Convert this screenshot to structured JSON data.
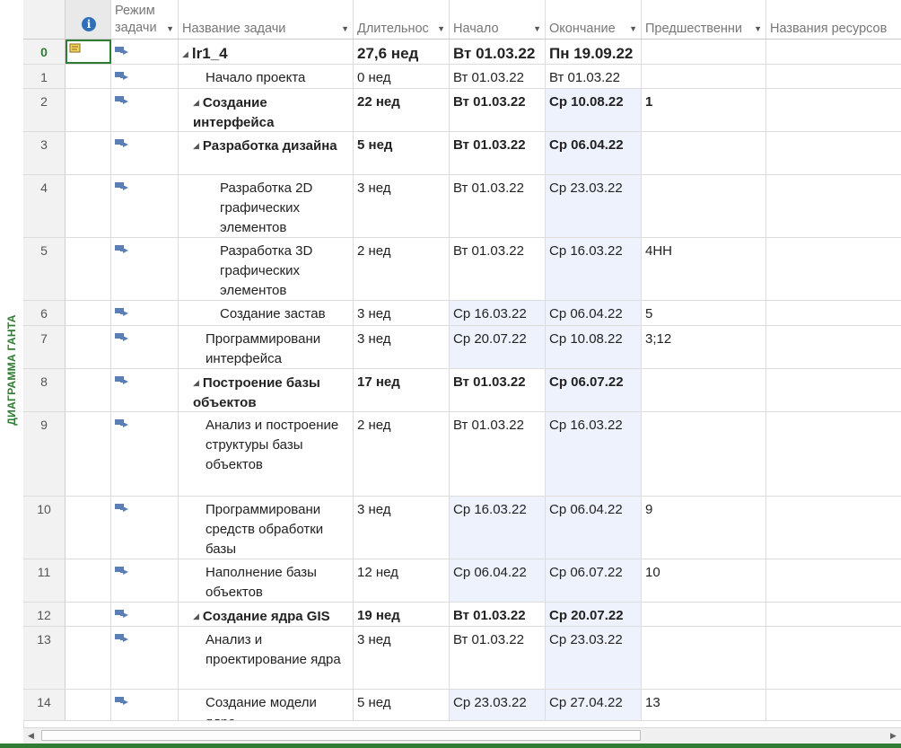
{
  "view_label": "ДИАГРАММА ГАНТА",
  "colors": {
    "accent": "#2e7d32",
    "highlight": "#eef2fc",
    "mode_icon": "#5b7fb4"
  },
  "columns": {
    "info_icon": "info-icon",
    "mode": "Режим задачи",
    "name": "Название задачи",
    "duration": "Длительнос",
    "start": "Начало",
    "finish": "Окончание",
    "predecessors": "Предшественни",
    "resources": "Названия ресурсов"
  },
  "rows": [
    {
      "id": "0",
      "name": "lr1_4",
      "duration": "27,6 нед",
      "start": "Вт 01.03.22",
      "finish": "Пн 19.09.22",
      "pred": "",
      "level": 0,
      "summary": true
    },
    {
      "id": "1",
      "name": "Начало проекта",
      "duration": "0 нед",
      "start": "Вт 01.03.22",
      "finish": "Вт 01.03.22",
      "pred": "",
      "level": 1,
      "summary": false
    },
    {
      "id": "2",
      "name": "Создание интерфейса",
      "duration": "22 нед",
      "start": "Вт 01.03.22",
      "finish": "Ср 10.08.22",
      "pred": "1",
      "level": 1,
      "summary": true
    },
    {
      "id": "3",
      "name": "Разработка дизайна",
      "duration": "5 нед",
      "start": "Вт 01.03.22",
      "finish": "Ср 06.04.22",
      "pred": "",
      "level": 2,
      "summary": true
    },
    {
      "id": "4",
      "name": "Разработка 2D графических элементов",
      "duration": "3 нед",
      "start": "Вт 01.03.22",
      "finish": "Ср 23.03.22",
      "pred": "",
      "level": 3,
      "summary": false
    },
    {
      "id": "5",
      "name": "Разработка 3D графических элементов",
      "duration": "2 нед",
      "start": "Вт 01.03.22",
      "finish": "Ср 16.03.22",
      "pred": "4НН",
      "level": 3,
      "summary": false
    },
    {
      "id": "6",
      "name": "Создание застав",
      "duration": "3 нед",
      "start": "Ср 16.03.22",
      "finish": "Ср 06.04.22",
      "pred": "5",
      "level": 3,
      "summary": false
    },
    {
      "id": "7",
      "name": "Программировани интерфейса",
      "duration": "3 нед",
      "start": "Ср 20.07.22",
      "finish": "Ср 10.08.22",
      "pred": "3;12",
      "level": 2,
      "summary": false
    },
    {
      "id": "8",
      "name": "Построение базы объектов",
      "duration": "17 нед",
      "start": "Вт 01.03.22",
      "finish": "Ср 06.07.22",
      "pred": "",
      "level": 1,
      "summary": true
    },
    {
      "id": "9",
      "name": "Анализ и построение структуры базы объектов",
      "duration": "2 нед",
      "start": "Вт 01.03.22",
      "finish": "Ср 16.03.22",
      "pred": "",
      "level": 2,
      "summary": false
    },
    {
      "id": "10",
      "name": "Программировани средств обработки базы",
      "duration": "3 нед",
      "start": "Ср 16.03.22",
      "finish": "Ср 06.04.22",
      "pred": "9",
      "level": 2,
      "summary": false
    },
    {
      "id": "11",
      "name": "Наполнение базы объектов",
      "duration": "12 нед",
      "start": "Ср 06.04.22",
      "finish": "Ср 06.07.22",
      "pred": "10",
      "level": 2,
      "summary": false
    },
    {
      "id": "12",
      "name": "Создание ядра GIS",
      "duration": "19 нед",
      "start": "Вт 01.03.22",
      "finish": "Ср 20.07.22",
      "pred": "",
      "level": 1,
      "summary": true
    },
    {
      "id": "13",
      "name": "Анализ и проектирование ядра",
      "duration": "3 нед",
      "start": "Вт 01.03.22",
      "finish": "Ср 23.03.22",
      "pred": "",
      "level": 2,
      "summary": false
    },
    {
      "id": "14",
      "name": "Создание модели ядра",
      "duration": "5 нед",
      "start": "Ср 23.03.22",
      "finish": "Ср 27.04.22",
      "pred": "13",
      "level": 2,
      "summary": false
    }
  ]
}
